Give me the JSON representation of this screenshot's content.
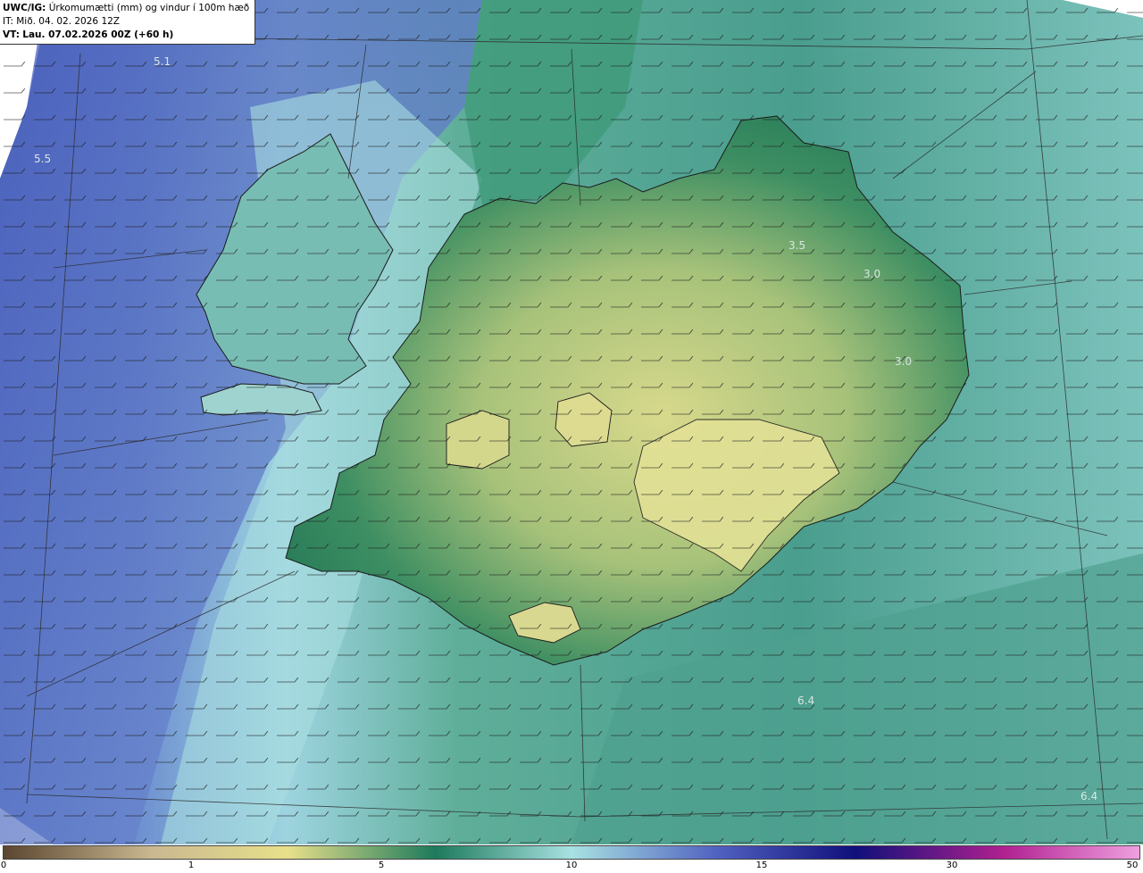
{
  "header": {
    "model": "UWC/IG:",
    "title": "Úrkomumætti (mm) og vindur í 100m hæð",
    "init_time": "IT: Mið. 04. 02. 2026 12Z",
    "valid_time_label": "VT:",
    "valid_time": "Lau. 07.02.2026 00Z (+60 h)"
  },
  "map_labels": [
    {
      "text": "5.1",
      "name": "label-5-1"
    },
    {
      "text": "5.5",
      "name": "label-5-5"
    },
    {
      "text": "3.5",
      "name": "label-3-5"
    },
    {
      "text": "3.0",
      "name": "label-3-0-a"
    },
    {
      "text": "3.0",
      "name": "label-3-0-b"
    },
    {
      "text": "6.4",
      "name": "label-6-4-a"
    },
    {
      "text": "6.4",
      "name": "label-6-4-b"
    }
  ],
  "colorbar": {
    "ticks": [
      "0",
      "1",
      "5",
      "10",
      "15",
      "30",
      "50"
    ],
    "colors": [
      "#5b4530",
      "#c9b890",
      "#e8e08a",
      "#1d7a5c",
      "#a8e2e2",
      "#5060c0",
      "#10107a",
      "#b02090",
      "#f0a0e0"
    ]
  },
  "colors": {
    "ocean_teal": "#4a9e8e",
    "land_green": "#2e8a60",
    "land_yellow": "#d6d98a",
    "west_blue": "#5a75c8",
    "light_cyan": "#a5dadd"
  }
}
